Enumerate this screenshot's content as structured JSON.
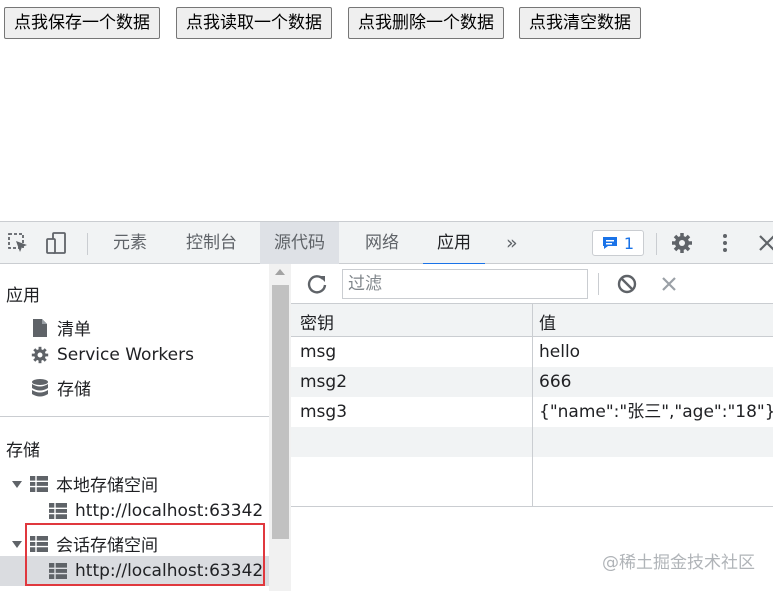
{
  "page": {
    "buttons": [
      "点我保存一个数据",
      "点我读取一个数据",
      "点我删除一个数据",
      "点我清空数据"
    ]
  },
  "devtools": {
    "tabs": [
      "元素",
      "控制台",
      "源代码",
      "网络",
      "应用"
    ],
    "more_tabs": "»",
    "issues_count": "1",
    "icons": [
      "inspect-icon",
      "device-icon",
      "more-tabs-icon",
      "issues-icon",
      "gear-icon",
      "kebab-icon",
      "close-icon"
    ],
    "sidebar": {
      "app_title": "应用",
      "app_items": [
        "清单",
        "Service Workers",
        "存储"
      ],
      "storage_title": "存储",
      "local_storage": "本地存储空间",
      "local_origin": "http://localhost:63342",
      "session_storage": "会话存储空间",
      "session_origin": "http://localhost:63342"
    },
    "filter": {
      "placeholder": "过滤"
    },
    "table": {
      "headers": [
        "密钥",
        "值"
      ],
      "rows": [
        {
          "key": "msg",
          "value": "hello"
        },
        {
          "key": "msg2",
          "value": "666"
        },
        {
          "key": "msg3",
          "value": "{\"name\":\"张三\",\"age\":\"18\"}"
        }
      ]
    },
    "watermark": "@稀土掘金技术社区",
    "accent": "#1a73e8",
    "highlight_color": "#e0383e"
  }
}
